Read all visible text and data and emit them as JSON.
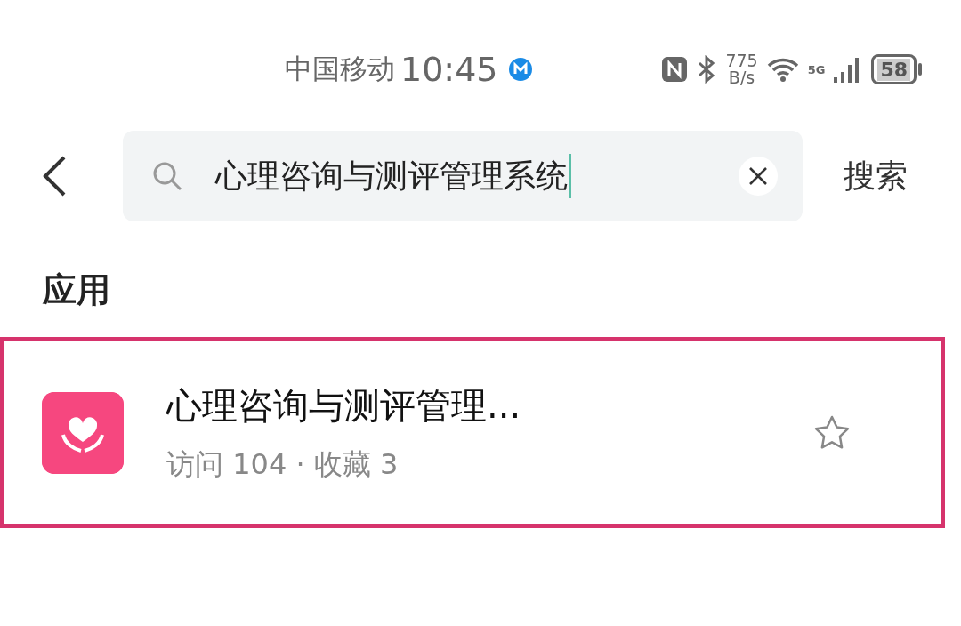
{
  "status_bar": {
    "carrier": "中国移动",
    "time": "10:45",
    "net_speed_value": "775",
    "net_speed_unit": "B/s",
    "network_type": "5G",
    "battery": "58"
  },
  "search": {
    "value": "心理咨询与测评管理系统",
    "button": "搜索"
  },
  "section_title": "应用",
  "results": [
    {
      "title": "心理咨询与测评管理...",
      "stats": "访问 104 · 收藏 3",
      "favorited": false,
      "highlighted": true
    }
  ]
}
